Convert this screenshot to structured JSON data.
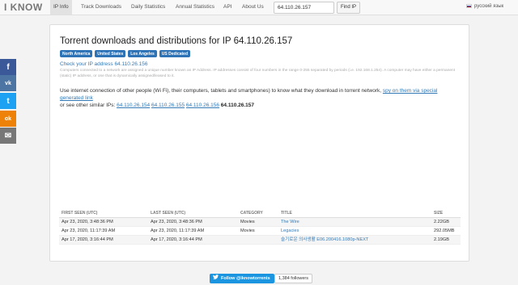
{
  "navbar": {
    "brand": "I KNOW",
    "items": [
      {
        "label": "IP Info",
        "active": true
      },
      {
        "label": "Track Downloads"
      },
      {
        "label": "Daily Statistics"
      },
      {
        "label": "Annual Statistics"
      },
      {
        "label": "API"
      },
      {
        "label": "About Us"
      }
    ],
    "search_value": "64.110.26.157",
    "find_button": "Find IP",
    "language": "русский язык"
  },
  "share": [
    {
      "icon": "facebook-icon",
      "glyph": "f",
      "color": "#3b5998"
    },
    {
      "icon": "vk-icon",
      "glyph": "vk",
      "color": "#4c75a3"
    },
    {
      "icon": "twitter-icon",
      "glyph": "t",
      "color": "#1da1f2"
    },
    {
      "icon": "odnoklassniki-icon",
      "glyph": "ok",
      "color": "#ee8208"
    },
    {
      "icon": "mail-icon",
      "glyph": "✉",
      "color": "#777777"
    }
  ],
  "main": {
    "title": "Torrent downloads and distributions for IP 64.110.26.157",
    "badges": [
      "North America",
      "United States",
      "Los Angeles",
      "US Dedicated"
    ],
    "check_link": "Check your IP address 64.110.26.156",
    "explanation": "Computers connected to a network are assigned a unique number known as IP Address. IP addresses consist of four numbers in the range 0-255 separated by periods (i.e. 192.168.1.254). A computer may have either a permanent (static) IP address, or one that is dynamically assigned/leased to it.",
    "desc_prefix": "Use internet connection of other people (Wi Fi), their computers, tablets and smartphones) to know what they download in torrent network, ",
    "desc_link": "spy on them via special generated link",
    "similar_prefix": "or see other similar IPs: ",
    "similar_ips": [
      "64.110.26.154",
      "64.110.26.155",
      "64.110.26.156"
    ],
    "current_ip": "64.110.26.157"
  },
  "table": {
    "headers": [
      "FIRST SEEN (UTC)",
      "LAST SEEN (UTC)",
      "CATEGORY",
      "TITLE",
      "SIZE"
    ],
    "rows": [
      {
        "first": "Apr 23, 2020, 3:48:36 PM",
        "last": "Apr 23, 2020, 3:48:36 PM",
        "category": "Movies",
        "title": "The Wire",
        "size": "2.22GB"
      },
      {
        "first": "Apr 23, 2020, 11:17:39 AM",
        "last": "Apr 23, 2020, 11:17:39 AM",
        "category": "Movies",
        "title": "Legacies",
        "size": "292.05MB"
      },
      {
        "first": "Apr 17, 2020, 3:16:44 PM",
        "last": "Apr 17, 2020, 3:16:44 PM",
        "category": "",
        "title": "슬기로운 의사생활 E06.200416.1080p-NEXT",
        "size": "2.19GB"
      }
    ]
  },
  "twitter": {
    "follow_label": "Follow @iknowtorrents",
    "followers": "1,384 followers"
  }
}
